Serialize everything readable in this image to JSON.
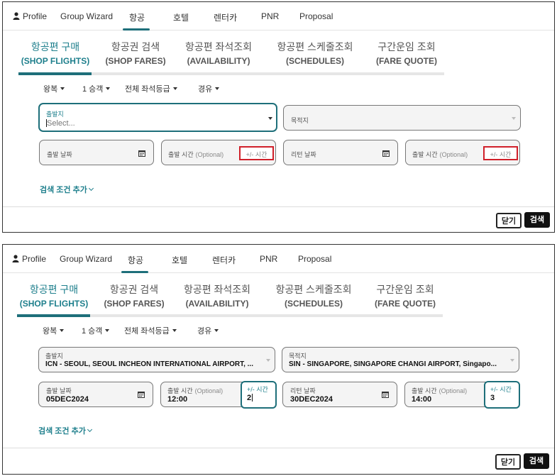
{
  "nav": {
    "profile": "Profile",
    "group_wizard": "Group Wizard",
    "flights": "항공",
    "hotel": "호텔",
    "rentacar": "렌터카",
    "pnr": "PNR",
    "proposal": "Proposal"
  },
  "tabs": [
    {
      "ko": "항공편 구매",
      "en": "(SHOP FLIGHTS)"
    },
    {
      "ko": "항공권 검색",
      "en": "(SHOP FARES)"
    },
    {
      "ko": "항공편 좌석조회",
      "en": "(AVAILABILITY)"
    },
    {
      "ko": "항공편 스케줄조회",
      "en": "(SCHEDULES)"
    },
    {
      "ko": "구간운임 조회",
      "en": "(FARE QUOTE)"
    }
  ],
  "options": {
    "trip_type": "왕복",
    "passengers": "1 승객",
    "cabin": "전체 좌석등급",
    "stops": "경유"
  },
  "labels": {
    "origin": "출발지",
    "destination": "목적지",
    "depart_date": "출발 날짜",
    "depart_time": "출발 시간",
    "optional": "(Optional)",
    "plus_minus": "+/- 시간",
    "return_date": "리턴 날짜",
    "more_conditions": "검색 조건 추가",
    "close": "닫기",
    "search": "검색"
  },
  "panel1": {
    "origin_placeholder": "Select..."
  },
  "panel2": {
    "origin": "ICN - SEOUL, SEOUL INCHEON INTERNATIONAL AIRPORT, ...",
    "destination": "SIN - SINGAPORE, SINGAPORE CHANGI AIRPORT, Singapo...",
    "depart_date": "05DEC2024",
    "depart_time": "12:00",
    "depart_plus": "2",
    "return_date": "30DEC2024",
    "return_time": "14:00",
    "return_plus": "3"
  },
  "colors": {
    "accent": "#1e6f7a",
    "highlight_red": "#d0202a"
  }
}
